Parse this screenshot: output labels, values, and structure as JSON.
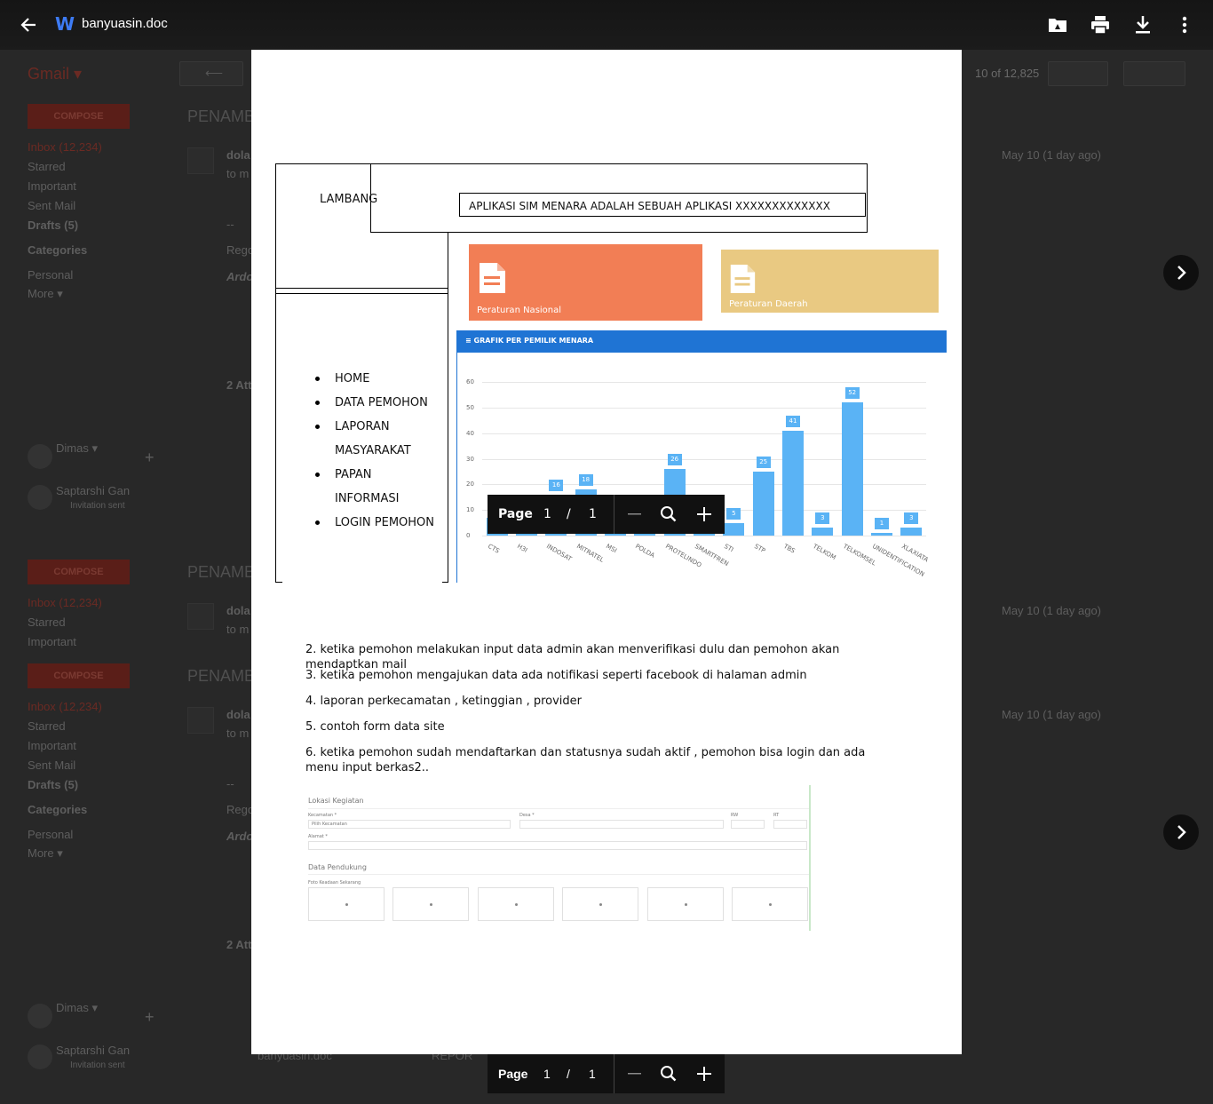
{
  "viewer": {
    "file_title": "banyuasin.doc"
  },
  "gmail": {
    "logo": "Gmail ▾",
    "pager": "10 of 12,825",
    "sections": [
      {
        "compose": "COMPOSE",
        "inbox": "Inbox (12,234)",
        "starred": "Starred",
        "important": "Important",
        "sent": "Sent Mail",
        "drafts": "Drafts (5)",
        "categories": "Categories",
        "personal": "Personal",
        "more": "More ▾"
      },
      {
        "compose": "COMPOSE",
        "inbox": "Inbox (12,234)",
        "starred": "Starred",
        "important": "Important"
      },
      {
        "compose": "COMPOSE",
        "inbox": "Inbox (12,234)",
        "starred": "Starred",
        "important": "Important",
        "sent": "Sent Mail",
        "drafts": "Drafts (5)",
        "categories": "Categories",
        "personal": "Personal",
        "more": "More ▾"
      }
    ],
    "subject": "PENAMB",
    "sender_short": "dola",
    "to_short": "to m",
    "date": "May 10 (1 day ago)",
    "dash": "--",
    "rego": "Rego",
    "ardo": "Ardo",
    "attachments": "2 Att",
    "chat_contact_1": "Dimas ▾",
    "chat_contact_2": "Saptarshi Gan",
    "chat_status_2": "Invitation sent",
    "attachment_name": "banyuasin.doc",
    "attachment_name_2": "REPOR"
  },
  "doc": {
    "lambang": "LAMBANG",
    "app_title": "APLIKASI SIM MENARA ADALAH SEBUAH APLIKASI XXXXXXXXXXXXX",
    "card_nasional": "Peraturan Nasional",
    "card_daerah": "Peraturan Daerah",
    "chart_header": "GRAFIK PER PEMILIK MENARA",
    "menu": [
      "HOME",
      "DATA PEMOHON",
      "LAPORAN",
      "MASYARAKAT",
      "PAPAN",
      "INFORMASI",
      "LOGIN PEMOHON"
    ],
    "paras": [
      "2. ketika pemohon melakukan input data admin akan menverifikasi dulu dan pemohon akan mendaptkan mail",
      "3.  ketika pemohon mengajukan data ada notifikasi seperti facebook di halaman admin",
      "4.  laporan perkecamatan , ketinggian , provider",
      "5.  contoh form  data  site",
      "6. ketika pemohon sudah mendaftarkan dan statusnya sudah aktif , pemohon bisa login dan ada menu input berkas2.."
    ],
    "form": {
      "section1": "Lokasi Kegiatan",
      "kecamatan_label": "Kecamatan *",
      "kecamatan_placeholder": "Pilih Kecamatan",
      "desa_label": "Desa *",
      "rw_label": "RW",
      "rt_label": "RT",
      "alamat_label": "Alamat *",
      "section2": "Data Pendukung",
      "foto_label": "Foto Keadaan Sekarang"
    }
  },
  "chart_data": {
    "type": "bar",
    "title": "GRAFIK PER PEMILIK MENARA",
    "categories": [
      "CTS",
      "H3I",
      "INDOSAT",
      "MITRATEL",
      "MSI",
      "POLDA",
      "PROTELINDO",
      "SMARTFREN",
      "STI",
      "STP",
      "TBS",
      "TELKOM",
      "TELKOMSEL",
      "UNIDENTIFICATION",
      "XLAXIATA"
    ],
    "values": [
      7,
      2,
      16,
      18,
      9,
      8,
      26,
      3,
      5,
      25,
      41,
      3,
      52,
      1,
      3
    ],
    "yticks": [
      0,
      10,
      20,
      30,
      40,
      50,
      60
    ],
    "ylim": [
      0,
      60
    ],
    "grid": true,
    "color": "#5ab3f5"
  },
  "page_control": {
    "label": "Page",
    "current": "1",
    "sep": "/",
    "total": "1"
  }
}
